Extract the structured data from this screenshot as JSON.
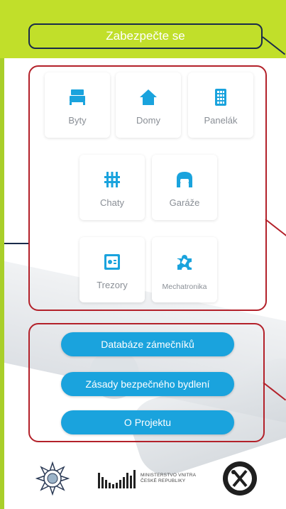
{
  "header": {
    "title": "Zabezpečte se"
  },
  "categories": [
    {
      "id": "byty",
      "label": "Byty",
      "icon": "bed-icon"
    },
    {
      "id": "domy",
      "label": "Domy",
      "icon": "house-icon"
    },
    {
      "id": "panelak",
      "label": "Panelák",
      "icon": "building-icon"
    },
    {
      "id": "chaty",
      "label": "Chaty",
      "icon": "fence-icon"
    },
    {
      "id": "garaze",
      "label": "Garáže",
      "icon": "garage-car-icon"
    },
    {
      "id": "trezory",
      "label": "Trezory",
      "icon": "safe-icon"
    },
    {
      "id": "mechatronika",
      "label": "Mechatronika",
      "icon": "puzzle-icon"
    }
  ],
  "buttons": {
    "database": "Databáze zámečníků",
    "principles": "Zásady bezpečného bydlení",
    "about": "O Projektu"
  },
  "footer": {
    "ministry_line1": "MINISTERSTVO VNITRA",
    "ministry_line2": "ČESKÉ REPUBLIKY"
  },
  "colors": {
    "accent_green": "#c1df2a",
    "primary_blue": "#1aa3dd",
    "annotation_red": "#b3212a",
    "annotation_navy": "#1a2b4a"
  }
}
